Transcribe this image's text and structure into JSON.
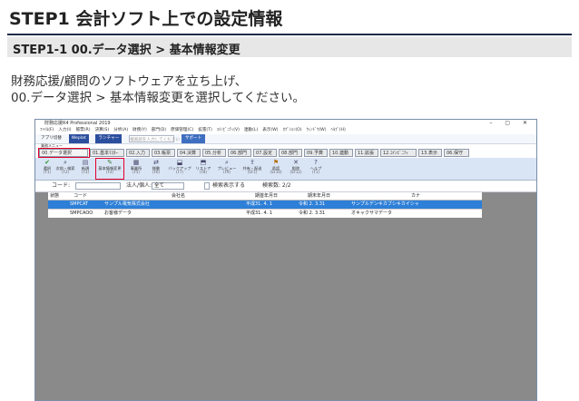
{
  "slide": {
    "title": "STEP1 会計ソフト上での設定情報",
    "subtitle": "STEP1-1 00.データ選択 > 基本情報変更",
    "body_line1": "財務応援/顧問のソフトウェアを立ち上げ、",
    "body_line2": "00.データ選択 > 基本情報変更を選択してください。"
  },
  "app": {
    "window_title": "財務応援R4 Professional 2019",
    "window_controls": "–  ▢  ✕",
    "menu": [
      "ﾌｧｲﾙ(F)",
      "入力(I)",
      "帳票(R)",
      "決算(S)",
      "分析(A)",
      "財務(Y)",
      "部門(D)",
      "原価管理(C)",
      "拡張(T)",
      "ｺｲﾝﾋﾞﾆﾃｨ(V)",
      "連動(L)",
      "表示(W)",
      "ｵﾌﾟｼｮﾝ(O)",
      "ｳｨﾝﾄﾞｳ(W)",
      "ﾍﾙﾌﾟ(H)"
    ],
    "toolbar": {
      "app_label": "アプリ切替",
      "weplat": "Weplat",
      "launcher": "ランチャー",
      "search_placeholder": "検索語を入力してください",
      "support": "サポート"
    },
    "menu_row_label": "業務メニュー",
    "tabs": [
      "00.データ選択",
      "01.基本ﾏｽﾀｰ",
      "02.入力",
      "03.帳票",
      "04.決算",
      "05.分析",
      "06.部門",
      "07.設定",
      "08.部門",
      "09.予算",
      "10.連動",
      "11.拡張",
      "12.ｺｲﾝﾋﾞﾆﾃｨ",
      "13.表示",
      "06.保守"
    ],
    "icon_buttons": [
      {
        "label": "選択",
        "fkey": "(F1)",
        "icon": "check-icon"
      },
      {
        "label": "次前・検索",
        "fkey": "(F2)",
        "icon": "search-icon"
      },
      {
        "label": "新規",
        "fkey": "(F3)",
        "icon": "new-icon"
      },
      {
        "label": "基本情報変更",
        "fkey": "(F4)",
        "icon": "edit-icon"
      },
      {
        "label": "事業所",
        "fkey": "(F5)",
        "icon": "building-icon"
      },
      {
        "label": "移動",
        "fkey": "(F6)",
        "icon": "move-icon"
      },
      {
        "label": "バックアップ",
        "fkey": "(F7)",
        "icon": "backup-icon"
      },
      {
        "label": "リストア",
        "fkey": "(F8)",
        "icon": "restore-icon"
      },
      {
        "label": "プレビュー",
        "fkey": "(F9)",
        "icon": "preview-icon"
      },
      {
        "label": "共有・配送",
        "fkey": "(SF1)",
        "icon": "share-icon"
      },
      {
        "label": "承認",
        "fkey": "(SF10)",
        "icon": "approve-icon"
      },
      {
        "label": "削除",
        "fkey": "(SF12)",
        "icon": "delete-icon"
      },
      {
        "label": "ヘルプ",
        "fkey": "(F1)",
        "icon": "help-icon"
      }
    ],
    "filter": {
      "code_label": "コード:",
      "corp_label": "法人/個人:",
      "corp_value": "全て",
      "checkbox_label": "検索表示する",
      "count_label": "検索数: 2/2"
    },
    "grid": {
      "headers": [
        "状態",
        "コード",
        "会社名",
        "期首年月日",
        "期末年月日",
        "カナ"
      ],
      "rows": [
        [
          "",
          "SMPCAT",
          "サンプル電気株式会社",
          "平成31. 4. 1",
          "令和 2. 3.31",
          "サンプルデンキカブシキカイシャ"
        ],
        [
          "",
          "SMPCAOO",
          "お客様データ",
          "平成31. 4. 1",
          "令和 2. 3.31",
          "オキャクサマデータ"
        ]
      ]
    }
  },
  "colors": {
    "accent": "#1f2d4a",
    "highlight": "#e3002b",
    "selected_row": "#2d7fd8"
  }
}
